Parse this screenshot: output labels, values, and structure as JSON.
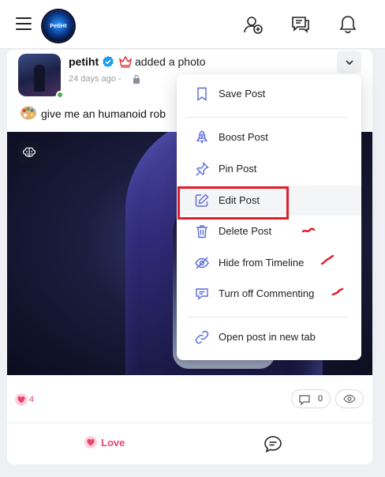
{
  "topbar": {
    "logo_text": "PetiHt",
    "icons": [
      "hamburger-menu-icon",
      "add-user-icon",
      "messages-icon",
      "bell-icon"
    ]
  },
  "post": {
    "username": "petiht",
    "action": "added a photo",
    "time": "24 days ago -",
    "text": "give me an humanoid rob",
    "reaction_count": "4",
    "comment_count": "0",
    "love_label": "Love"
  },
  "menu": {
    "items": [
      {
        "label": "Save Post",
        "icon": "bookmark-icon"
      },
      {
        "label": "Boost Post",
        "icon": "rocket-icon"
      },
      {
        "label": "Pin Post",
        "icon": "pin-icon"
      },
      {
        "label": "Edit Post",
        "icon": "edit-icon"
      },
      {
        "label": "Delete Post",
        "icon": "trash-icon"
      },
      {
        "label": "Hide from Timeline",
        "icon": "eye-off-icon"
      },
      {
        "label": "Turn off Commenting",
        "icon": "comment-off-icon"
      },
      {
        "label": "Open post in new tab",
        "icon": "link-icon"
      }
    ]
  },
  "colors": {
    "accent_red": "#e11d2a",
    "love_pink": "#e8466a",
    "verified_blue": "#1d9bf0",
    "online_green": "#4caf50"
  }
}
